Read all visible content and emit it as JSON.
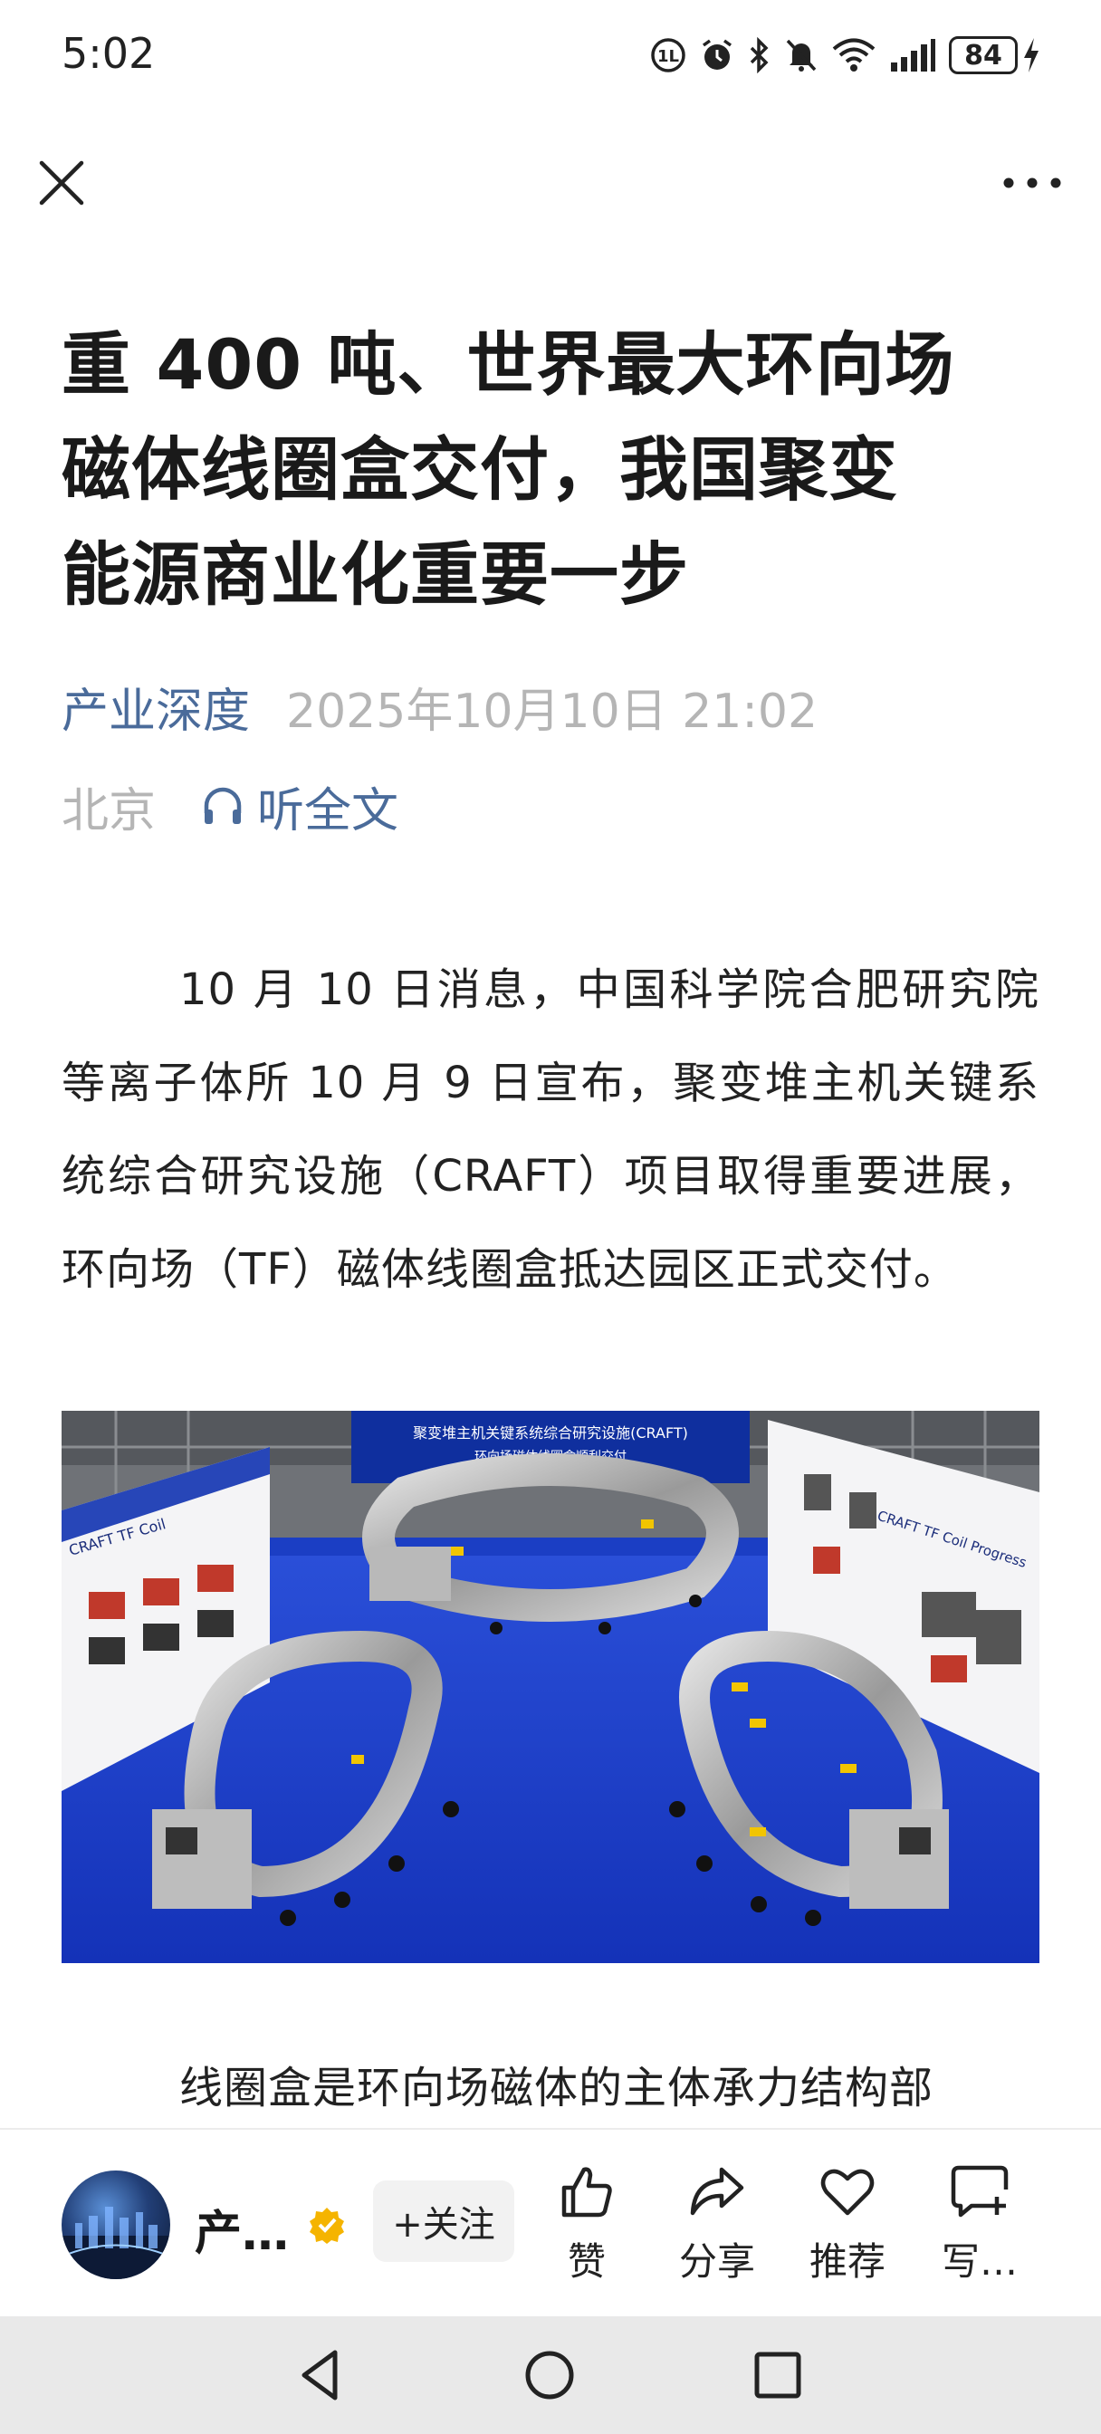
{
  "status_bar": {
    "time": "5:02",
    "battery": "84",
    "icons": [
      "hd-icon",
      "alarm-icon",
      "bluetooth-icon",
      "mute-icon",
      "wifi-icon",
      "signal-icon",
      "battery-icon",
      "charging-icon"
    ]
  },
  "nav": {
    "close_icon": "close-icon",
    "more_icon": "more-icon"
  },
  "article": {
    "title_line1": "重 400 吨、世界最大环向场",
    "title_line2": "磁体线圈盒交付，我国聚变",
    "title_line3": "能源商业化重要一步",
    "source": "产业深度",
    "date": "2025年10月10日 21:02",
    "location": "北京",
    "listen_label": "听全文",
    "paragraph1": "10 月 10 日消息，中国科学院合肥研究院等离子体所 10 月 9 日宣布，聚变堆主机关键系统综合研究设施（CRAFT）项目取得重要进展，环向场（TF）磁体线圈盒抵达园区正式交付。",
    "paragraph2": "线圈盒是环向场磁体的主体承力结构部",
    "photo": {
      "banner_line1": "聚变堆主机关键系统综合研究设施(CRAFT)",
      "banner_line2": "环向场磁体线圈盒顺利交付",
      "left_board": "CRAFT TF Coil",
      "right_board": "CRAFT TF Coil Progress"
    }
  },
  "action_bar": {
    "author": "产…",
    "follow_label": "+关注",
    "like_label": "赞",
    "share_label": "分享",
    "recommend_label": "推荐",
    "write_label": "写…"
  },
  "colors": {
    "link": "#4a6b9a",
    "meta_gray": "#b5b5b5",
    "verified": "#f5b400",
    "photo_floor": "#1b3ec4"
  }
}
